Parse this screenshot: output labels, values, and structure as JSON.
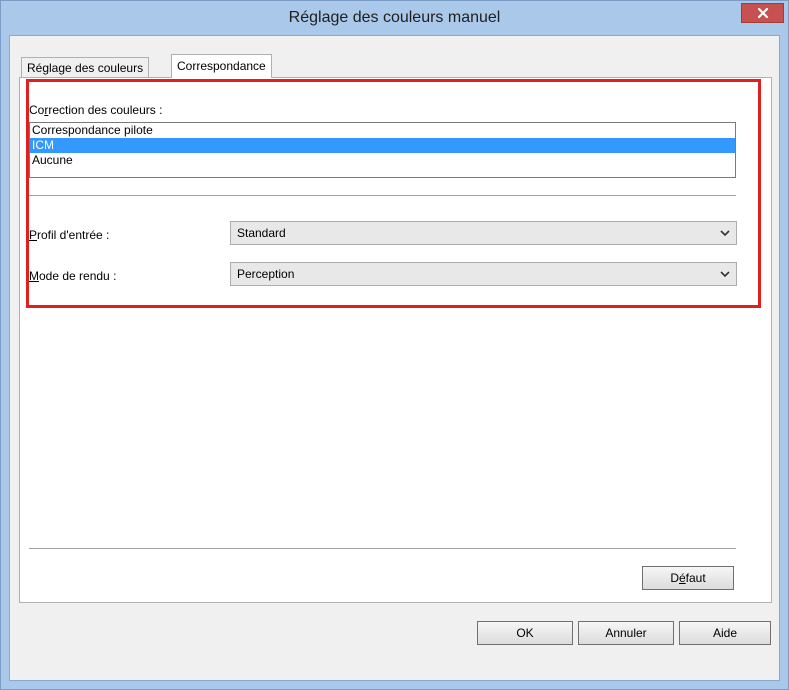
{
  "window": {
    "title": "Réglage des couleurs manuel",
    "close_label": "×"
  },
  "tabs": [
    {
      "label": "Réglage des couleurs",
      "active": false
    },
    {
      "label": "Correspondance",
      "active": true
    }
  ],
  "color_correction": {
    "label_pre": "Co",
    "label_key": "r",
    "label_post": "rection des couleurs :",
    "options": [
      "Correspondance pilote",
      "ICM",
      "Aucune"
    ],
    "selected": "ICM"
  },
  "input_profile": {
    "label_key": "P",
    "label_post": "rofil d'entrée :",
    "value": "Standard"
  },
  "rendering_mode": {
    "label_key": "M",
    "label_post": "ode de rendu :",
    "value": "Perception"
  },
  "buttons": {
    "default_pre": "D",
    "default_key": "é",
    "default_post": "faut",
    "ok": "OK",
    "cancel": "Annuler",
    "help": "Aide"
  },
  "colors": {
    "highlight": "#e0201f",
    "selection": "#3399ff",
    "titlebar": "#a9c8ea",
    "close_button": "#c75050"
  }
}
